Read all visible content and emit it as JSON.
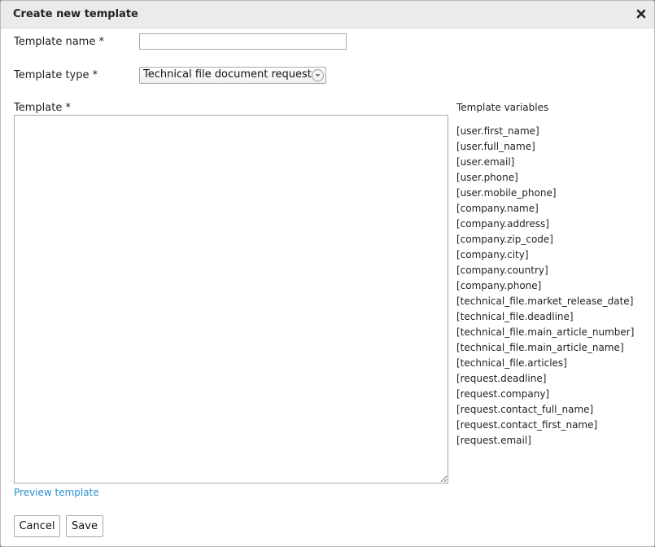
{
  "dialog": {
    "title": "Create new template",
    "close_icon": "close-icon"
  },
  "form": {
    "name_label": "Template name *",
    "name_value": "",
    "name_placeholder": "",
    "type_label": "Template type *",
    "type_selected": "Technical file document request",
    "template_label": "Template *",
    "template_value": ""
  },
  "variables": {
    "title": "Template variables",
    "items": [
      "[user.first_name]",
      "[user.full_name]",
      "[user.email]",
      "[user.phone]",
      "[user.mobile_phone]",
      "[company.name]",
      "[company.address]",
      "[company.zip_code]",
      "[company.city]",
      "[company.country]",
      "[company.phone]",
      "[technical_file.market_release_date]",
      "[technical_file.deadline]",
      "[technical_file.main_article_number]",
      "[technical_file.main_article_name]",
      "[technical_file.articles]",
      "[request.deadline]",
      "[request.company]",
      "[request.contact_full_name]",
      "[request.contact_first_name]",
      "[request.email]"
    ]
  },
  "actions": {
    "preview_link": "Preview template",
    "cancel_label": "Cancel",
    "save_label": "Save"
  },
  "colors": {
    "link": "#2e8fd1",
    "titlebar": "#ebebeb"
  }
}
